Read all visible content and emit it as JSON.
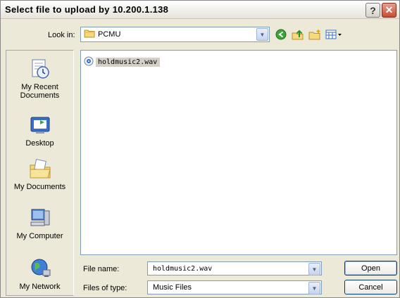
{
  "window": {
    "title": "Select file to upload by 10.200.1.138",
    "help_label": "?",
    "close_label": "✕"
  },
  "toolbar": {
    "look_in_label": "Look in:",
    "look_in_value": "PCMU",
    "icons": [
      "back-icon",
      "up-folder-icon",
      "new-folder-icon",
      "views-menu-icon"
    ]
  },
  "places": [
    {
      "label": "My Recent Documents",
      "icon": "recent-documents-icon"
    },
    {
      "label": "Desktop",
      "icon": "desktop-icon"
    },
    {
      "label": "My Documents",
      "icon": "my-documents-icon"
    },
    {
      "label": "My Computer",
      "icon": "my-computer-icon"
    },
    {
      "label": "My Network",
      "icon": "my-network-icon"
    }
  ],
  "files": [
    {
      "name": "holdmusic2.wav",
      "selected": true
    }
  ],
  "form": {
    "file_name_label": "File name:",
    "file_name_value": "holdmusic2.wav",
    "file_type_label": "Files of type:",
    "file_type_value": "Music Files",
    "open_label": "Open",
    "cancel_label": "Cancel"
  },
  "colors": {
    "accent": "#316ac5",
    "selection": "#d4d0c8",
    "face": "#ece9d8"
  }
}
